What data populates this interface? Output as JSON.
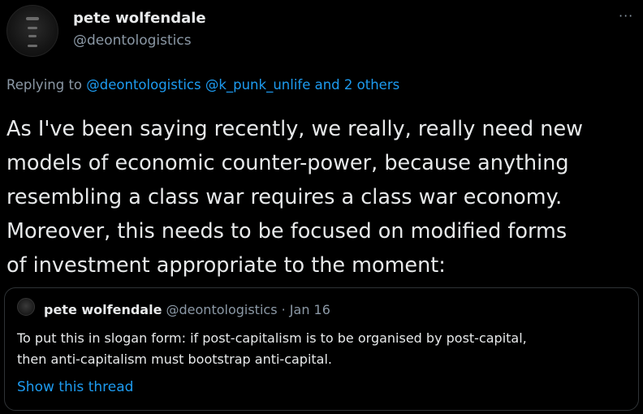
{
  "author": {
    "display_name": "pete wolfendale",
    "handle": "@deontologistics"
  },
  "reply": {
    "prefix": "Replying to ",
    "mentions": "@deontologistics @k_punk_unlife and 2 others"
  },
  "tweet": {
    "text": "As I've been saying recently, we really, really need new\nmodels of economic counter-power, because anything\nresembling a class war requires a class war economy.\nMoreover, this needs to be focused on modified forms\nof investment appropriate to the moment:"
  },
  "quote": {
    "display_name": "pete wolfendale",
    "handle": "@deontologistics",
    "separator": " · ",
    "date": "Jan 16",
    "text": "To put this in slogan form: if post-capitalism is to be organised by post-capital,\nthen anti-capitalism must bootstrap anti-capital.",
    "show_thread_label": "Show this thread"
  },
  "icons": {
    "more": "more-horizontal-icon"
  },
  "colors": {
    "background": "#000000",
    "text": "#e7e9ea",
    "secondary": "#8b98a5",
    "link": "#1d9bf0",
    "border": "#2f3336"
  }
}
